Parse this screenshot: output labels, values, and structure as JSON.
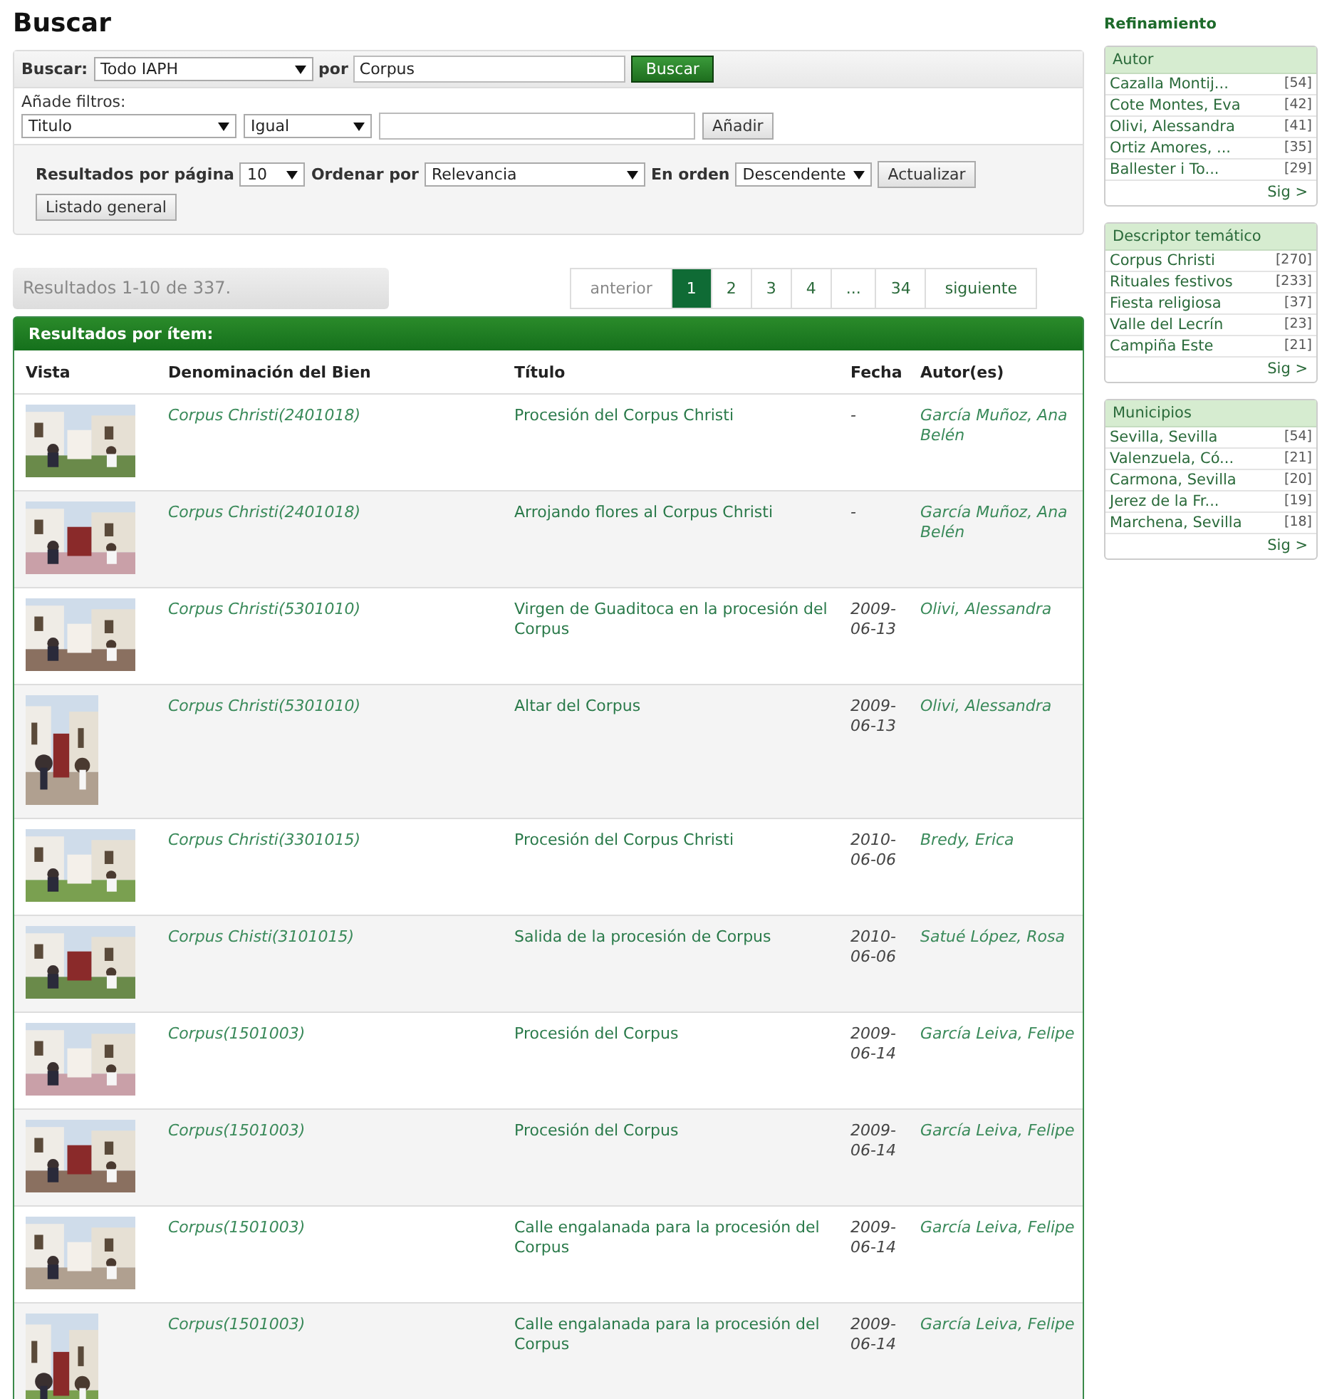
{
  "page_title": "Buscar",
  "search": {
    "label": "Buscar:",
    "scope": "Todo IAPH",
    "by_label": "por",
    "query": "Corpus",
    "button": "Buscar"
  },
  "filters": {
    "label": "Añade filtros:",
    "field": "Titulo",
    "operator": "Igual",
    "button": "Añadir"
  },
  "options": {
    "per_page_label": "Resultados por página",
    "per_page": "10",
    "order_label": "Ordenar por",
    "order": "Relevancia",
    "direction_label": "En orden",
    "direction": "Descendente",
    "update_button": "Actualizar",
    "general_button": "Listado general"
  },
  "results_count": "Resultados 1-10 de 337.",
  "pagination": [
    {
      "label": "anterior",
      "selected": false,
      "disabled": true
    },
    {
      "label": "1",
      "selected": true,
      "disabled": false
    },
    {
      "label": "2",
      "selected": false,
      "disabled": false
    },
    {
      "label": "3",
      "selected": false,
      "disabled": false
    },
    {
      "label": "4",
      "selected": false,
      "disabled": false
    },
    {
      "label": "...",
      "selected": false,
      "disabled": false
    },
    {
      "label": "34",
      "selected": false,
      "disabled": false
    },
    {
      "label": "siguiente",
      "selected": false,
      "disabled": false
    }
  ],
  "results": {
    "heading": "Resultados por ítem:",
    "columns": [
      "Vista",
      "Denominación del Bien",
      "Título",
      "Fecha",
      "Autor(es)"
    ],
    "rows": [
      {
        "portrait": false,
        "name": "Corpus Christi(2401018)",
        "title": "Procesión del Corpus Christi",
        "date": "-",
        "authors": "García Muñoz, Ana Belén"
      },
      {
        "portrait": false,
        "name": "Corpus Christi(2401018)",
        "title": "Arrojando flores al Corpus Christi",
        "date": "-",
        "authors": "García Muñoz, Ana Belén"
      },
      {
        "portrait": false,
        "name": "Corpus Christi(5301010)",
        "title": "Virgen de Guaditoca en la procesión del Corpus",
        "date": "2009-06-13",
        "authors": "Olivi, Alessandra"
      },
      {
        "portrait": true,
        "name": "Corpus Christi(5301010)",
        "title": "Altar del Corpus",
        "date": "2009-06-13",
        "authors": "Olivi, Alessandra"
      },
      {
        "portrait": false,
        "name": "Corpus Christi(3301015)",
        "title": "Procesión del Corpus Christi",
        "date": "2010-06-06",
        "authors": "Bredy, Erica"
      },
      {
        "portrait": false,
        "name": "Corpus Chisti(3101015)",
        "title": "Salida de la procesión de Corpus",
        "date": "2010-06-06",
        "authors": "Satué López, Rosa"
      },
      {
        "portrait": false,
        "name": "Corpus(1501003)",
        "title": "Procesión del Corpus",
        "date": "2009-06-14",
        "authors": "García Leiva, Felipe"
      },
      {
        "portrait": false,
        "name": "Corpus(1501003)",
        "title": "Procesión del Corpus",
        "date": "2009-06-14",
        "authors": "García Leiva, Felipe"
      },
      {
        "portrait": false,
        "name": "Corpus(1501003)",
        "title": "Calle engalanada para la procesión del Corpus",
        "date": "2009-06-14",
        "authors": "García Leiva, Felipe"
      },
      {
        "portrait": true,
        "name": "Corpus(1501003)",
        "title": "Calle engalanada para la procesión del Corpus",
        "date": "2009-06-14",
        "authors": "García Leiva, Felipe"
      }
    ]
  },
  "sidebar": {
    "title": "Refinamiento",
    "groups": [
      {
        "title": "Autor",
        "more": "Sig >",
        "items": [
          {
            "label": "Cazalla Montij...",
            "count": "[54]"
          },
          {
            "label": "Cote Montes, Eva",
            "count": "[42]"
          },
          {
            "label": "Olivi, Alessandra",
            "count": "[41]"
          },
          {
            "label": "Ortiz Amores, ...",
            "count": "[35]"
          },
          {
            "label": "Ballester i To...",
            "count": "[29]"
          }
        ]
      },
      {
        "title": "Descriptor temático",
        "more": "Sig >",
        "items": [
          {
            "label": "Corpus Christi",
            "count": "[270]"
          },
          {
            "label": "Rituales festivos",
            "count": "[233]"
          },
          {
            "label": "Fiesta religiosa",
            "count": "[37]"
          },
          {
            "label": "Valle del Lecrín",
            "count": "[23]"
          },
          {
            "label": "Campiña Este",
            "count": "[21]"
          }
        ]
      },
      {
        "title": "Municipios",
        "more": "Sig >",
        "items": [
          {
            "label": "Sevilla, Sevilla",
            "count": "[54]"
          },
          {
            "label": "Valenzuela, Có...",
            "count": "[21]"
          },
          {
            "label": "Carmona, Sevilla",
            "count": "[20]"
          },
          {
            "label": "Jerez de la Fr...",
            "count": "[19]"
          },
          {
            "label": "Marchena, Sevilla",
            "count": "[18]"
          }
        ]
      }
    ]
  }
}
